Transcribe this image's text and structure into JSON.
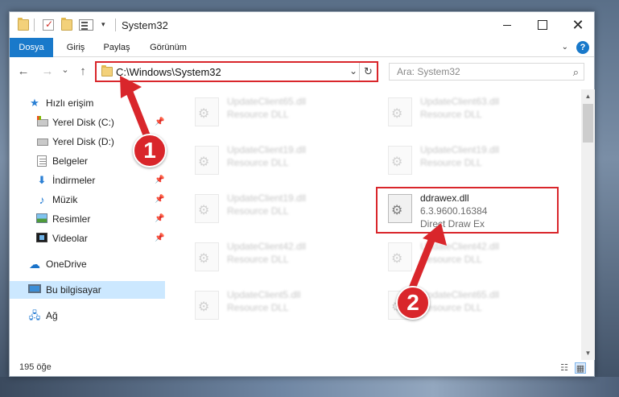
{
  "window": {
    "title": "System32",
    "qat_dropdown": "▾",
    "minimize": "",
    "maximize": "",
    "close": "✕"
  },
  "ribbon": {
    "tabs": [
      {
        "label": "Dosya"
      },
      {
        "label": "Giriş"
      },
      {
        "label": "Paylaş"
      },
      {
        "label": "Görünüm"
      }
    ],
    "expand": "⌄",
    "help": "?"
  },
  "nav": {
    "back": "←",
    "forward": "→",
    "recent": "⌄",
    "up": "↑"
  },
  "address": {
    "path": "C:\\Windows\\System32",
    "chevron": "⌄",
    "refresh": "↻"
  },
  "search": {
    "placeholder": "Ara: System32",
    "icon": "⌕"
  },
  "sidebar": {
    "items": [
      {
        "label": "Hızlı erişim",
        "icon": "star-icon"
      },
      {
        "label": "Yerel Disk (C:)",
        "icon": "disk-icon"
      },
      {
        "label": "Yerel Disk (D:)",
        "icon": "disk-icon"
      },
      {
        "label": "Belgeler",
        "icon": "documents-icon"
      },
      {
        "label": "İndirmeler",
        "icon": "download-icon"
      },
      {
        "label": "Müzik",
        "icon": "music-icon"
      },
      {
        "label": "Resimler",
        "icon": "pictures-icon"
      },
      {
        "label": "Videolar",
        "icon": "video-icon"
      },
      {
        "label": "OneDrive",
        "icon": "cloud-icon"
      },
      {
        "label": "Bu bilgisayar",
        "icon": "computer-icon"
      },
      {
        "label": "Ağ",
        "icon": "network-icon"
      }
    ],
    "pin_glyph": "📌",
    "icon_glyphs": {
      "star": "★",
      "download": "⬇",
      "music": "♪",
      "cloud": "☁",
      "network": "🖧"
    }
  },
  "files": [
    {
      "name": "UpdateClient65.dll",
      "type": "Resource DLL"
    },
    {
      "name": "UpdateClient63.dll",
      "type": "Resource DLL"
    },
    {
      "name": "UpdateClient19.dll",
      "type": "Resource DLL"
    },
    {
      "name": "UpdateClient19.dll",
      "type": "Resource DLL"
    },
    {
      "name": "UpdateClient19.dll",
      "type": "Resource DLL"
    },
    {
      "name": "ddrawex.dll",
      "version": "6.3.9600.16384",
      "type": "Direct Draw Ex"
    },
    {
      "name": "UpdateClient42.dll",
      "type": "Resource DLL"
    },
    {
      "name": "UpdateClient42.dll",
      "type": "Resource DLL"
    },
    {
      "name": "UpdateClient5.dll",
      "type": "Resource DLL"
    },
    {
      "name": "UpdateClient65.dll",
      "type": "Resource DLL"
    }
  ],
  "scrollbar": {
    "up": "▲",
    "down": "▼"
  },
  "status": {
    "count": "195 öğe",
    "details_view": "☷",
    "tiles_view": "▦"
  },
  "annotations": {
    "step1": "1",
    "step2": "2",
    "color": "#d9262b"
  }
}
